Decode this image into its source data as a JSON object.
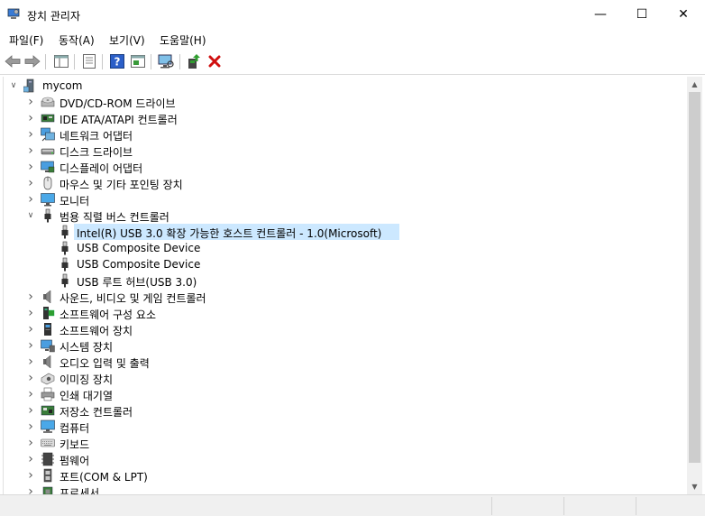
{
  "window": {
    "title": "장치 관리자",
    "minimize_glyph": "—",
    "maximize_glyph": "☐",
    "close_glyph": "✕"
  },
  "menu": [
    {
      "label": "파일(F)"
    },
    {
      "label": "동작(A)"
    },
    {
      "label": "보기(V)"
    },
    {
      "label": "도움말(H)"
    }
  ],
  "toolbar": [
    {
      "name": "back-button",
      "icon": "back-arrow-icon"
    },
    {
      "name": "forward-button",
      "icon": "forward-arrow-icon"
    },
    {
      "name": "show-hide-console-tree-button",
      "icon": "console-tree-icon"
    },
    {
      "name": "properties-button",
      "icon": "properties-icon"
    },
    {
      "name": "help-button",
      "icon": "help-icon"
    },
    {
      "name": "action-pane-button",
      "icon": "action-pane-icon"
    },
    {
      "name": "scan-hardware-button",
      "icon": "monitor-scan-icon"
    },
    {
      "name": "update-driver-button",
      "icon": "update-driver-icon"
    },
    {
      "name": "uninstall-device-button",
      "icon": "red-x-icon"
    }
  ],
  "tree": {
    "root": "mycom",
    "items": [
      {
        "label": "DVD/CD-ROM 드라이브",
        "icon": "dvd-drive-icon",
        "level": 1,
        "expanded": false
      },
      {
        "label": "IDE ATA/ATAPI 컨트롤러",
        "icon": "ide-controller-icon",
        "level": 1,
        "expanded": false
      },
      {
        "label": "네트워크 어댑터",
        "icon": "network-adapter-icon",
        "level": 1,
        "expanded": false
      },
      {
        "label": "디스크 드라이브",
        "icon": "disk-drive-icon",
        "level": 1,
        "expanded": false
      },
      {
        "label": "디스플레이 어댑터",
        "icon": "display-adapter-icon",
        "level": 1,
        "expanded": false
      },
      {
        "label": "마우스 및 기타 포인팅 장치",
        "icon": "mouse-icon",
        "level": 1,
        "expanded": false
      },
      {
        "label": "모니터",
        "icon": "monitor-icon",
        "level": 1,
        "expanded": false
      },
      {
        "label": "범용 직렬 버스 컨트롤러",
        "icon": "usb-icon",
        "level": 1,
        "expanded": true
      },
      {
        "label": "Intel(R) USB 3.0 확장 가능한 호스트 컨트롤러 - 1.0(Microsoft)",
        "icon": "usb-icon",
        "level": 2,
        "selected": true
      },
      {
        "label": "USB Composite Device",
        "icon": "usb-icon",
        "level": 2
      },
      {
        "label": "USB Composite Device",
        "icon": "usb-icon",
        "level": 2
      },
      {
        "label": "USB 루트 허브(USB 3.0)",
        "icon": "usb-icon",
        "level": 2
      },
      {
        "label": "사운드, 비디오 및 게임 컨트롤러",
        "icon": "speaker-icon",
        "level": 1,
        "expanded": false
      },
      {
        "label": "소프트웨어 구성 요소",
        "icon": "software-component-icon",
        "level": 1,
        "expanded": false
      },
      {
        "label": "소프트웨어 장치",
        "icon": "software-device-icon",
        "level": 1,
        "expanded": false
      },
      {
        "label": "시스템 장치",
        "icon": "system-device-icon",
        "level": 1,
        "expanded": false
      },
      {
        "label": "오디오 입력 및 출력",
        "icon": "speaker-icon",
        "level": 1,
        "expanded": false
      },
      {
        "label": "이미징 장치",
        "icon": "imaging-device-icon",
        "level": 1,
        "expanded": false
      },
      {
        "label": "인쇄 대기열",
        "icon": "printer-icon",
        "level": 1,
        "expanded": false
      },
      {
        "label": "저장소 컨트롤러",
        "icon": "storage-controller-icon",
        "level": 1,
        "expanded": false
      },
      {
        "label": "컴퓨터",
        "icon": "computer-icon",
        "level": 1,
        "expanded": false
      },
      {
        "label": "키보드",
        "icon": "keyboard-icon",
        "level": 1,
        "expanded": false
      },
      {
        "label": "펌웨어",
        "icon": "firmware-icon",
        "level": 1,
        "expanded": false
      },
      {
        "label": "포트(COM & LPT)",
        "icon": "port-icon",
        "level": 1,
        "expanded": false
      },
      {
        "label": "프로세서",
        "icon": "processor-icon",
        "level": 1,
        "expanded": false
      }
    ]
  },
  "colors": {
    "selection": "#cce8ff",
    "accent_blue": "#2b7fd6",
    "red_x": "#d01010",
    "green": "#2f9e2f"
  }
}
